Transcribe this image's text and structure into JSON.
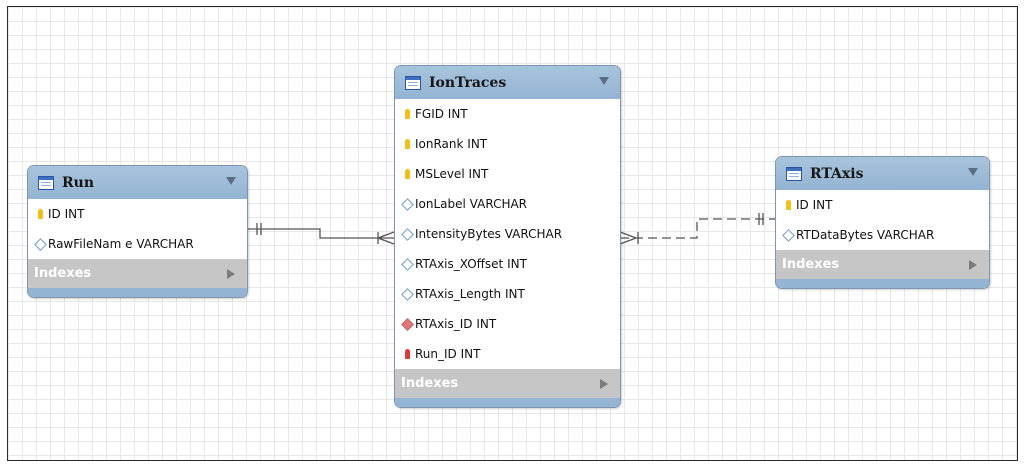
{
  "tables": {
    "run": {
      "title": "Run",
      "columns": [
        {
          "icon": "primary-key-icon",
          "text": "ID INT"
        },
        {
          "icon": "column-diamond-icon",
          "text": "RawFileNam e VARCHAR"
        }
      ],
      "indexes_label": "Indexes"
    },
    "iontraces": {
      "title": "IonTraces",
      "columns": [
        {
          "icon": "primary-key-icon",
          "text": "FGID INT"
        },
        {
          "icon": "primary-key-icon",
          "text": "IonRank INT"
        },
        {
          "icon": "primary-key-icon",
          "text": "MSLevel INT"
        },
        {
          "icon": "column-diamond-icon",
          "text": "IonLabel VARCHAR"
        },
        {
          "icon": "column-diamond-icon",
          "text": "IntensityBytes VARCHAR"
        },
        {
          "icon": "column-diamond-icon",
          "text": "RTAxis_XOffset INT"
        },
        {
          "icon": "column-diamond-icon",
          "text": "RTAxis_Length INT"
        },
        {
          "icon": "foreign-key-diamond-icon",
          "text": "RTAxis_ID INT"
        },
        {
          "icon": "foreign-primary-key-icon",
          "text": "Run_ID INT"
        }
      ],
      "indexes_label": "Indexes"
    },
    "rtaxis": {
      "title": "RTAxis",
      "columns": [
        {
          "icon": "primary-key-icon",
          "text": "ID INT"
        },
        {
          "icon": "column-diamond-icon",
          "text": "RTDataBytes VARCHAR"
        }
      ],
      "indexes_label": "Indexes"
    }
  },
  "relationships": [
    {
      "from": "Run",
      "to": "IonTraces",
      "style": "solid",
      "cardinality": "one-to-many"
    },
    {
      "from": "RTAxis",
      "to": "IonTraces",
      "style": "dashed",
      "cardinality": "one-to-many"
    }
  ],
  "colors": {
    "header": "#9dbcd8",
    "indexes_bar": "#c6c6c6",
    "grid_line": "#e7e7e7",
    "connector": "#555555"
  }
}
